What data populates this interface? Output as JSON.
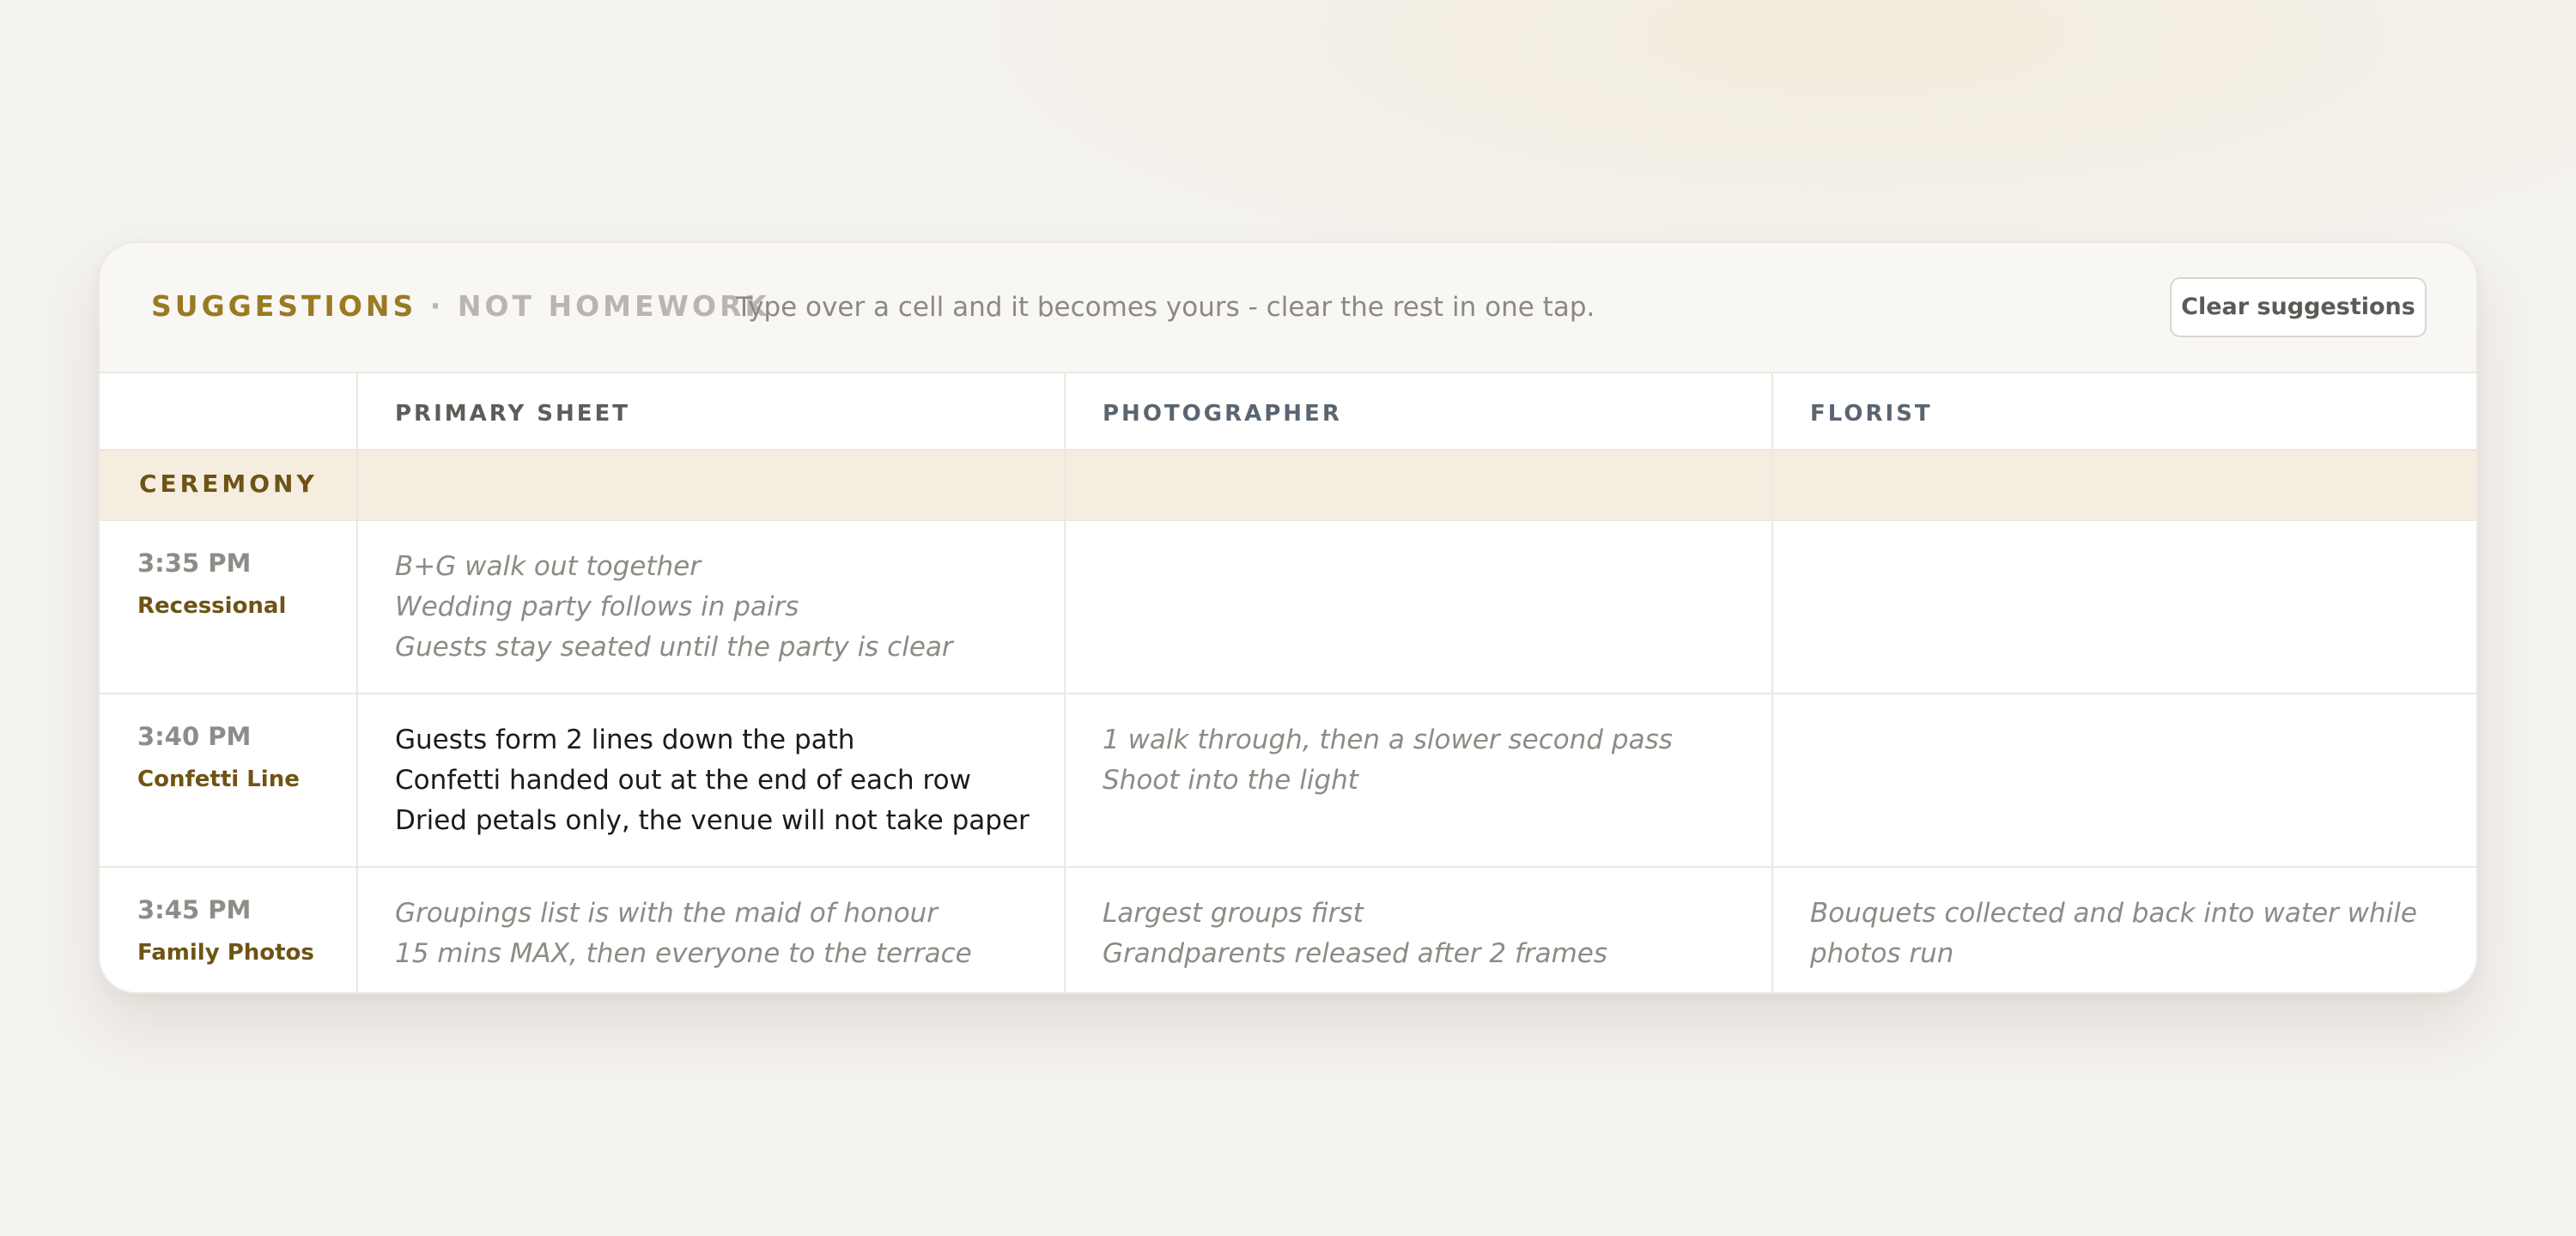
{
  "toolbar": {
    "label": "SUGGESTIONS",
    "separator": "·",
    "sublabel": "NOT HOMEWORK",
    "description": "Type over a cell and it becomes yours - clear the rest in one tap.",
    "clear_button": "Clear suggestions"
  },
  "columns": [
    {
      "label": "PRIMARY SHEET",
      "color": "#5e5c58"
    },
    {
      "label": "PHOTOGRAPHER",
      "color": "#5a6570"
    },
    {
      "label": "FLORIST",
      "color": "#5a6570"
    }
  ],
  "section": {
    "label": "CEREMONY"
  },
  "rows": [
    {
      "time": "3:35 PM",
      "activity": "Recessional",
      "cells": [
        {
          "state": "suggestion",
          "lines": [
            "B+G walk out together",
            "Wedding party follows in pairs",
            "Guests stay seated until the party is clear"
          ]
        },
        {
          "state": "empty",
          "lines": []
        },
        {
          "state": "empty",
          "lines": []
        }
      ]
    },
    {
      "time": "3:40 PM",
      "activity": "Confetti Line",
      "cells": [
        {
          "state": "user",
          "lines": [
            "Guests form 2 lines down the path",
            "Confetti handed out at the end of each row",
            "Dried petals only, the venue will not take paper"
          ]
        },
        {
          "state": "suggestion",
          "lines": [
            "1 walk through, then a slower second pass",
            "Shoot into the light"
          ]
        },
        {
          "state": "empty",
          "lines": []
        }
      ]
    },
    {
      "time": "3:45 PM",
      "activity": "Family Photos",
      "cells": [
        {
          "state": "suggestion",
          "lines": [
            "Groupings list is with the maid of honour",
            "15 mins MAX, then everyone to the terrace"
          ]
        },
        {
          "state": "suggestion",
          "lines": [
            "Largest groups first",
            "Grandparents released after 2 frames"
          ]
        },
        {
          "state": "suggestion",
          "lines": [
            "Bouquets collected and back into water while photos run"
          ]
        }
      ]
    }
  ],
  "colors": {
    "accent": "#9a7a22",
    "section_bg": "#f5eee0",
    "suggestion_text": "#8e8b85",
    "user_text": "#1c1b19"
  }
}
